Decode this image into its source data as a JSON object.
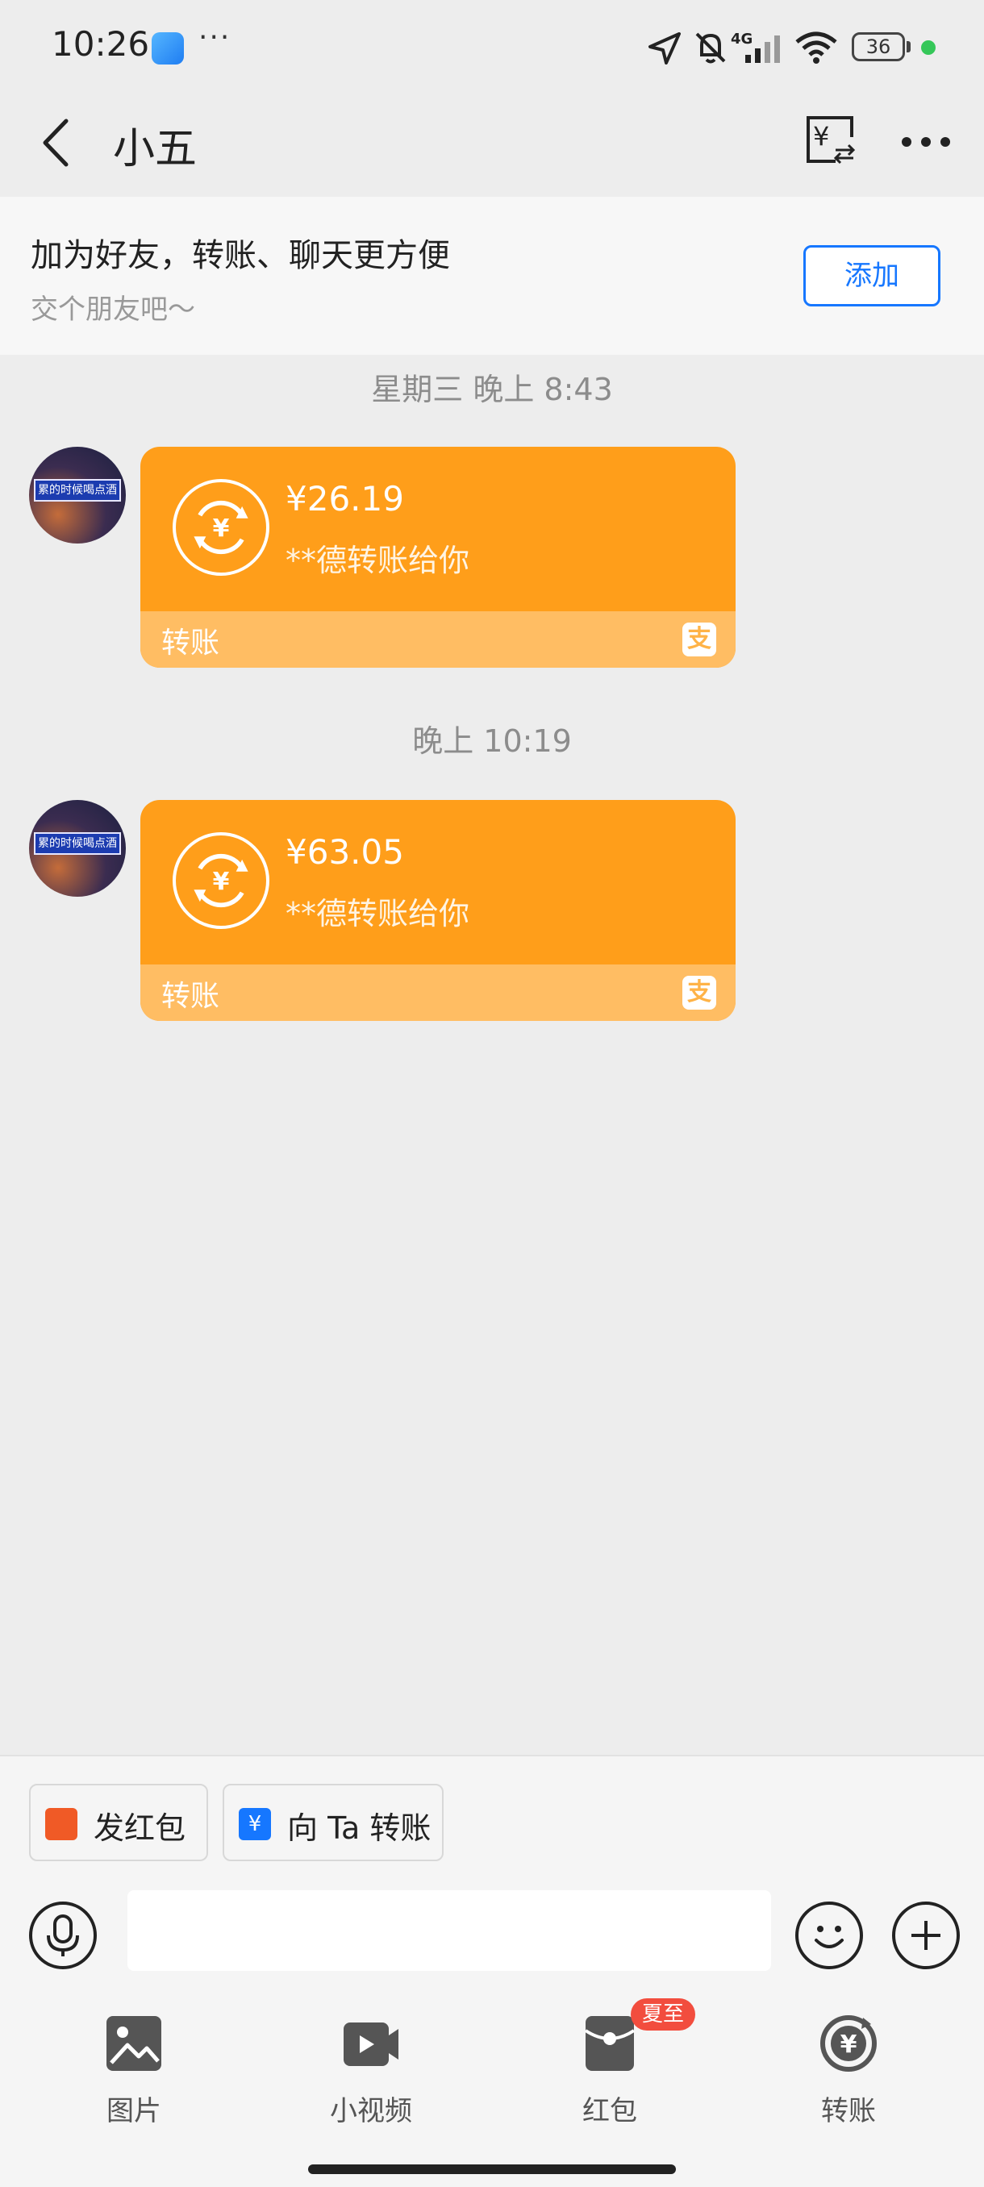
{
  "status_bar": {
    "time": "10:26",
    "dots": "···",
    "network": "4G",
    "battery": "36"
  },
  "header": {
    "title": "小五"
  },
  "banner": {
    "title": "加为好友，转账、聊天更方便",
    "subtitle": "交个朋友吧～",
    "add_label": "添加"
  },
  "messages": [
    {
      "timestamp": "星期三 晚上 8:43",
      "amount": "¥26.19",
      "desc": "**德转账给你",
      "footer": "转账",
      "avatar_text": "累的时候喝点酒"
    },
    {
      "timestamp": "晚上 10:19",
      "amount": "¥63.05",
      "desc": "**德转账给你",
      "footer": "转账",
      "avatar_text": "累的时候喝点酒"
    }
  ],
  "quick_actions": [
    {
      "label": "发红包",
      "icon": "red-envelope-icon",
      "color": "#f05a26"
    },
    {
      "label": "向 Ta 转账",
      "icon": "transfer-icon",
      "color": "#1677ff"
    }
  ],
  "input": {
    "value": ""
  },
  "tools": [
    {
      "label": "图片",
      "icon": "image-icon"
    },
    {
      "label": "小视频",
      "icon": "video-icon"
    },
    {
      "label": "红包",
      "icon": "red-packet-icon",
      "badge": "夏至"
    },
    {
      "label": "转账",
      "icon": "transfer-circle-icon"
    }
  ],
  "colors": {
    "card": "#ff9e1a",
    "card_footer": "#ffbd63",
    "accent": "#1677ff"
  }
}
